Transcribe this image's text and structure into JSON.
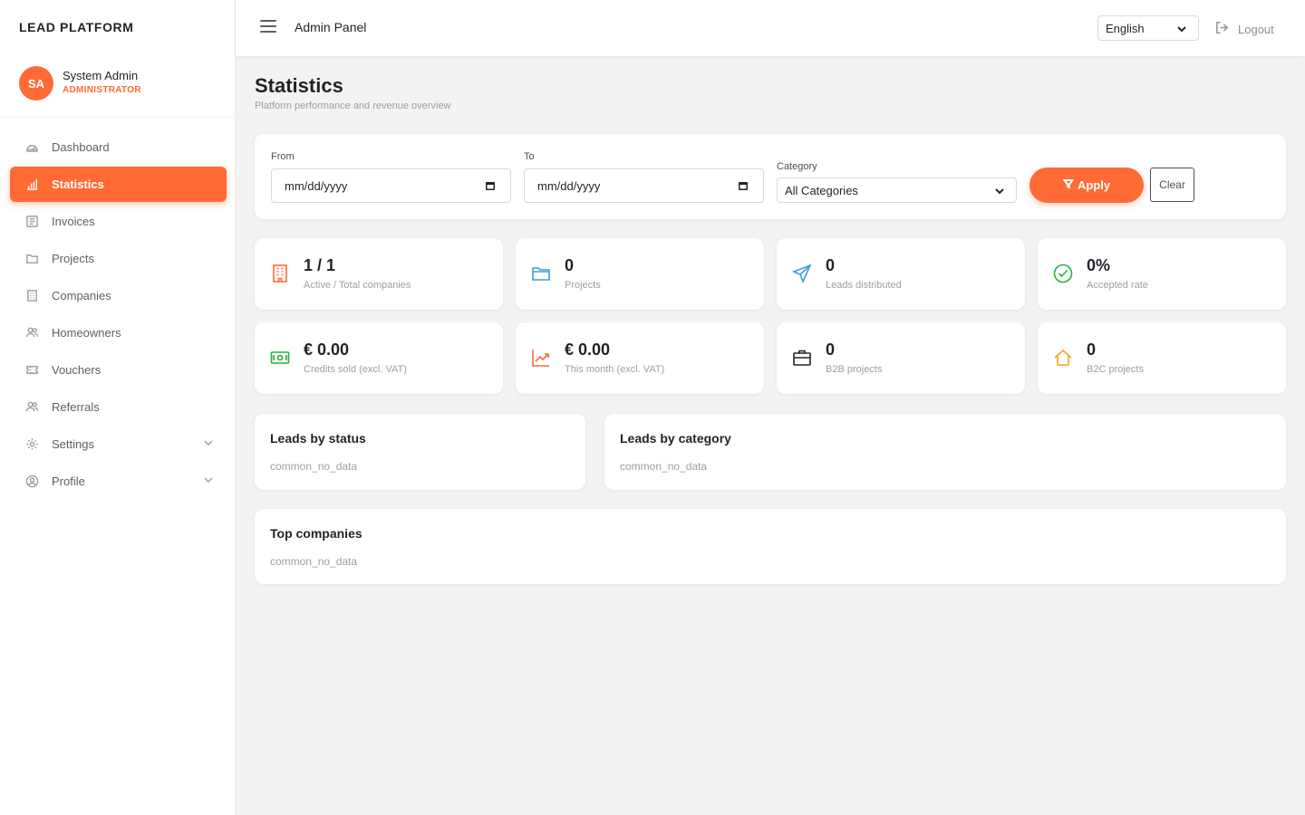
{
  "brand": "LEAD PLATFORM",
  "user": {
    "initials": "SA",
    "name": "System Admin",
    "role": "ADMINISTRATOR"
  },
  "nav": [
    {
      "label": "Dashboard",
      "icon": "gauge-icon"
    },
    {
      "label": "Statistics",
      "icon": "bar-chart-icon",
      "active": true
    },
    {
      "label": "Invoices",
      "icon": "receipt-icon"
    },
    {
      "label": "Projects",
      "icon": "folder-icon"
    },
    {
      "label": "Companies",
      "icon": "building-icon"
    },
    {
      "label": "Homeowners",
      "icon": "users-icon"
    },
    {
      "label": "Vouchers",
      "icon": "ticket-icon"
    },
    {
      "label": "Referrals",
      "icon": "users-icon"
    },
    {
      "label": "Settings",
      "icon": "gear-icon",
      "expandable": true
    },
    {
      "label": "Profile",
      "icon": "user-circle-icon",
      "expandable": true
    }
  ],
  "topbar": {
    "title": "Admin Panel",
    "language": "English",
    "logout": "Logout"
  },
  "page": {
    "title": "Statistics",
    "subtitle": "Platform performance and revenue overview"
  },
  "filters": {
    "from_label": "From",
    "from_value": "mm/dd/yyyy",
    "to_label": "To",
    "to_value": "mm/dd/yyyy",
    "category_label": "Category",
    "category_value": "All Categories",
    "apply": "Apply",
    "clear": "Clear"
  },
  "stats": [
    {
      "value": "1 / 1",
      "label": "Active / Total companies",
      "icon": "building-icon",
      "color": "#ff6a35"
    },
    {
      "value": "0",
      "label": "Projects",
      "icon": "folder-icon",
      "color": "#3b9ae1"
    },
    {
      "value": "0",
      "label": "Leads distributed",
      "icon": "send-icon",
      "color": "#3b9ae1"
    },
    {
      "value": "0%",
      "label": "Accepted rate",
      "icon": "check-circle-icon",
      "color": "#22b33a"
    },
    {
      "value": "€ 0.00",
      "label": "Credits sold (excl. VAT)",
      "icon": "cash-icon",
      "color": "#22b33a"
    },
    {
      "value": "€ 0.00",
      "label": "This month (excl. VAT)",
      "icon": "trend-up-icon",
      "color": "#ff6a35"
    },
    {
      "value": "0",
      "label": "B2B projects",
      "icon": "briefcase-icon",
      "color": "#1f2329"
    },
    {
      "value": "0",
      "label": "B2C projects",
      "icon": "home-icon",
      "color": "#f5a623"
    }
  ],
  "panels": {
    "leads_status": {
      "title": "Leads by status",
      "empty": "common_no_data"
    },
    "leads_category": {
      "title": "Leads by category",
      "empty": "common_no_data"
    },
    "top_companies": {
      "title": "Top companies",
      "empty": "common_no_data"
    }
  }
}
